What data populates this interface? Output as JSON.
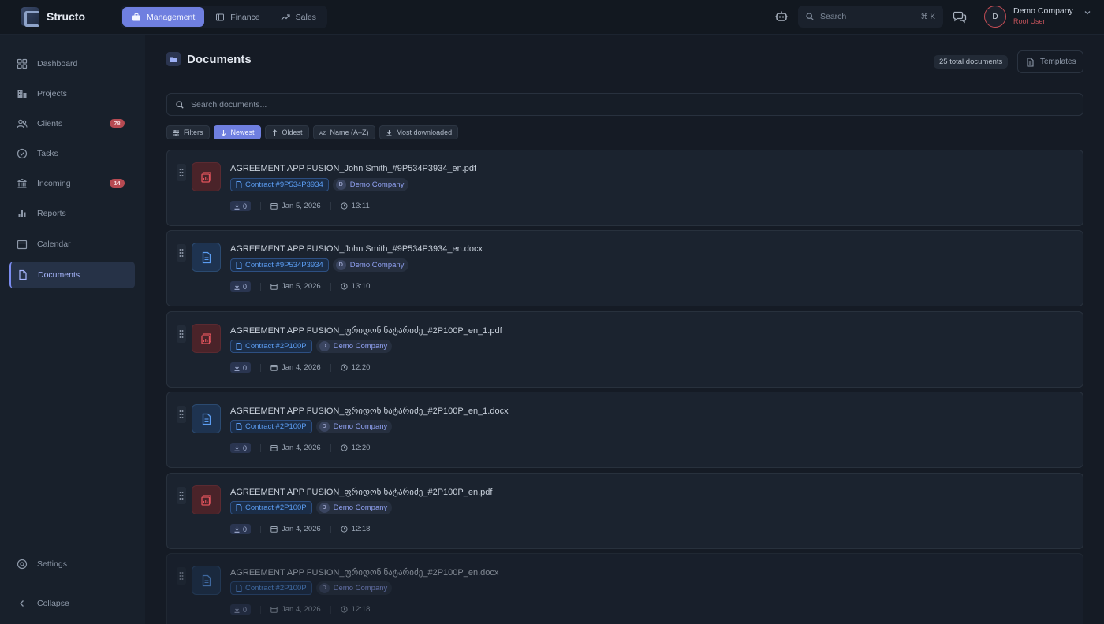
{
  "app": {
    "name": "Structo"
  },
  "mainnav": [
    {
      "label": "Management",
      "icon": "briefcase-icon",
      "active": true
    },
    {
      "label": "Finance",
      "icon": "finance-icon",
      "active": false
    },
    {
      "label": "Sales",
      "icon": "trend-icon",
      "active": false
    }
  ],
  "topbar": {
    "search_placeholder": "Search",
    "search_shortcut": "⌘ K",
    "user_initial": "D",
    "user_name": "Demo Company",
    "user_role": "Root User"
  },
  "sidebar": {
    "items": [
      {
        "label": "Dashboard",
        "icon": "grid-icon"
      },
      {
        "label": "Projects",
        "icon": "building-icon"
      },
      {
        "label": "Clients",
        "icon": "users-icon",
        "badge": "78"
      },
      {
        "label": "Tasks",
        "icon": "check-circle-icon"
      },
      {
        "label": "Incoming",
        "icon": "bank-icon",
        "badge": "14"
      },
      {
        "label": "Reports",
        "icon": "bar-chart-icon"
      },
      {
        "label": "Calendar",
        "icon": "calendar-icon"
      },
      {
        "label": "Documents",
        "icon": "document-icon",
        "active": true
      }
    ],
    "settings_label": "Settings",
    "collapse_label": "Collapse"
  },
  "page": {
    "title": "Documents",
    "total": "25 total documents",
    "templates_label": "Templates",
    "search_placeholder": "Search documents..."
  },
  "filters": [
    {
      "label": "Filters",
      "active": false
    },
    {
      "label": "Newest",
      "active": true
    },
    {
      "label": "Oldest",
      "active": false
    },
    {
      "label": "Name (A–Z)",
      "active": false
    },
    {
      "label": "Most downloaded",
      "active": false
    }
  ],
  "documents": [
    {
      "name": "AGREEMENT  APP FUSION_John Smith_#9P534P3934_en.pdf",
      "type": "pdf",
      "contract": "Contract #9P534P3934",
      "company_initial": "D",
      "company": "Demo Company",
      "downloads": "0",
      "date": "Jan 5, 2026",
      "time": "13:11"
    },
    {
      "name": "AGREEMENT  APP FUSION_John Smith_#9P534P3934_en.docx",
      "type": "docx",
      "contract": "Contract #9P534P3934",
      "company_initial": "D",
      "company": "Demo Company",
      "downloads": "0",
      "date": "Jan 5, 2026",
      "time": "13:10"
    },
    {
      "name": "AGREEMENT  APP FUSION_ფრიდონ ნატარიძე_#2P100P_en_1.pdf",
      "type": "pdf",
      "contract": "Contract #2P100P",
      "company_initial": "D",
      "company": "Demo Company",
      "downloads": "0",
      "date": "Jan 4, 2026",
      "time": "12:20"
    },
    {
      "name": "AGREEMENT  APP FUSION_ფრიდონ ნატარიძე_#2P100P_en_1.docx",
      "type": "docx",
      "contract": "Contract #2P100P",
      "company_initial": "D",
      "company": "Demo Company",
      "downloads": "0",
      "date": "Jan 4, 2026",
      "time": "12:20"
    },
    {
      "name": "AGREEMENT  APP FUSION_ფრიდონ ნატარიძე_#2P100P_en.pdf",
      "type": "pdf",
      "contract": "Contract #2P100P",
      "company_initial": "D",
      "company": "Demo Company",
      "downloads": "0",
      "date": "Jan 4, 2026",
      "time": "12:18"
    },
    {
      "name": "AGREEMENT  APP FUSION_ფრიდონ ნატარიძე_#2P100P_en.docx",
      "type": "docx",
      "contract": "Contract #2P100P",
      "company_initial": "D",
      "company": "Demo Company",
      "downloads": "0",
      "date": "Jan 4, 2026",
      "time": "12:18"
    }
  ],
  "colors": {
    "accent": "#6f7fe0",
    "danger": "#b64a52",
    "link": "#5b9cf0",
    "background": "#151b25"
  }
}
